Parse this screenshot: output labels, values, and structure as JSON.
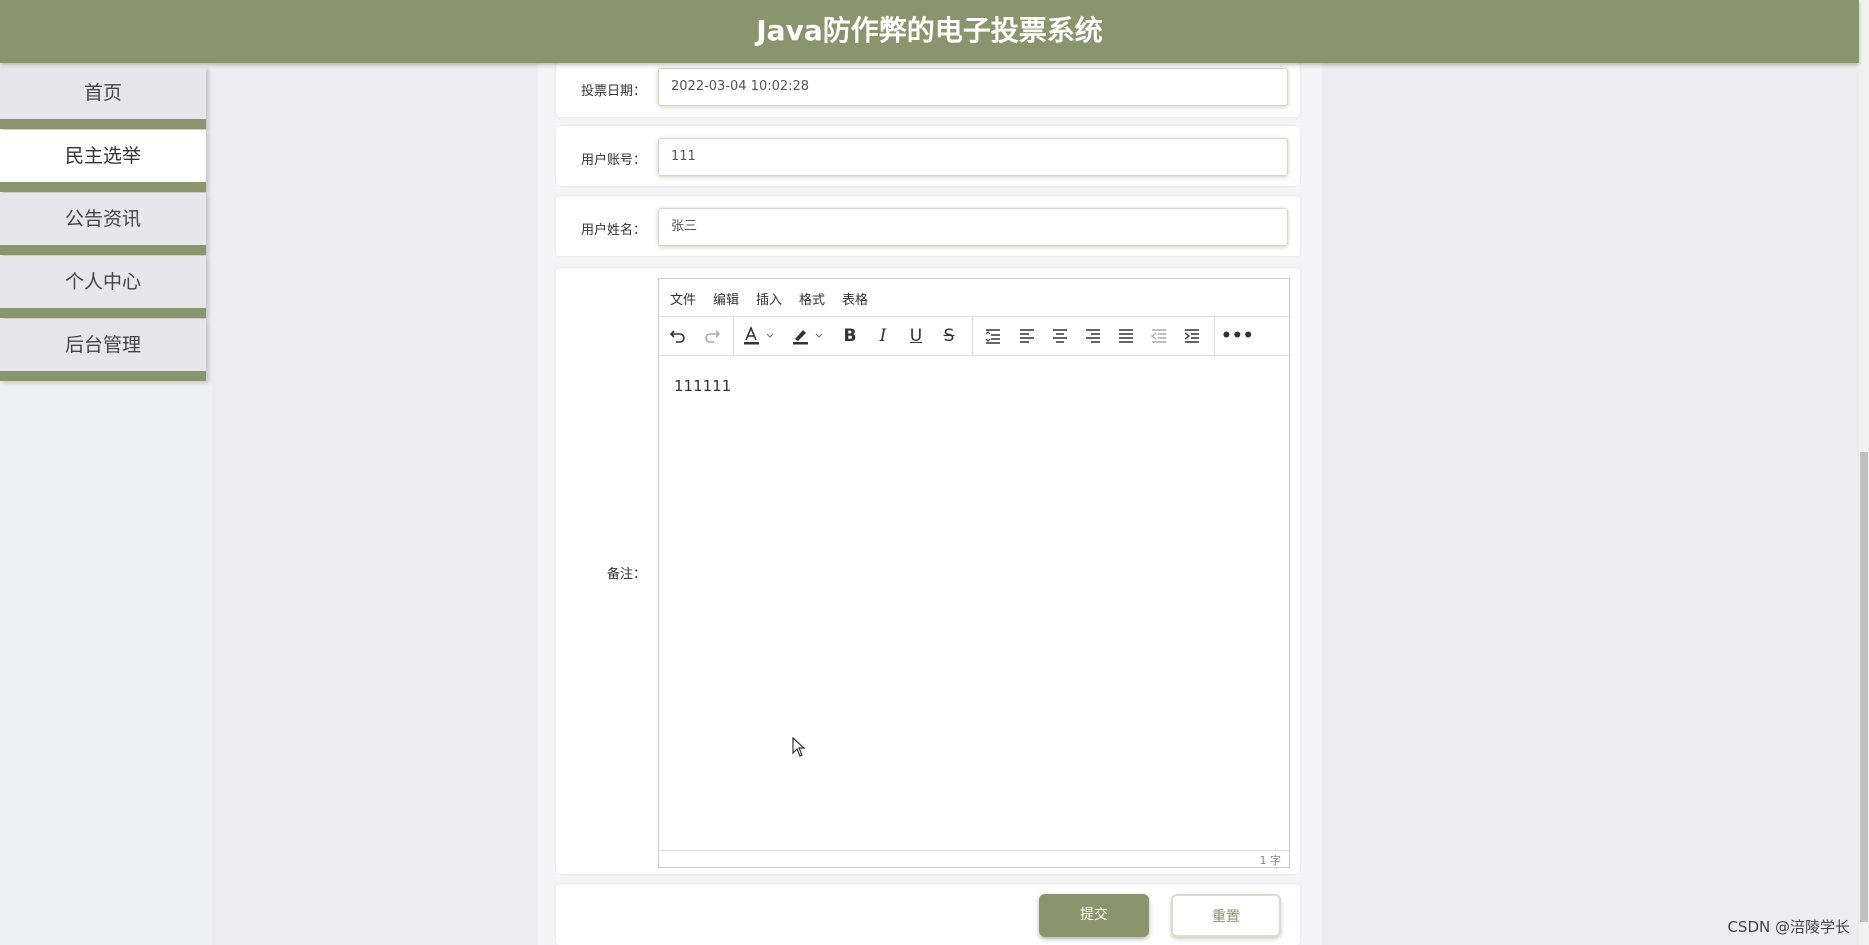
{
  "app": {
    "title": "Java防作弊的电子投票系统"
  },
  "nav": {
    "items": [
      {
        "label": "首页"
      },
      {
        "label": "民主选举",
        "active": true
      },
      {
        "label": "公告资讯"
      },
      {
        "label": "个人中心"
      },
      {
        "label": "后台管理"
      }
    ]
  },
  "form": {
    "vote_date": {
      "label": "投票日期：",
      "value": "2022-03-04 10:02:28"
    },
    "user_account": {
      "label": "用户账号：",
      "value": "111"
    },
    "user_name": {
      "label": "用户姓名：",
      "value": "张三"
    },
    "remarks": {
      "label": "备注：",
      "menu": [
        "文件",
        "编辑",
        "插入",
        "格式",
        "表格"
      ],
      "content": "111111",
      "word_count": "1 字"
    },
    "submit_label": "提交",
    "reset_label": "重置"
  },
  "watermark": "CSDN @涪陵学长",
  "colors": {
    "accent": "#8b956d",
    "page_bg": "#eeeef0"
  }
}
